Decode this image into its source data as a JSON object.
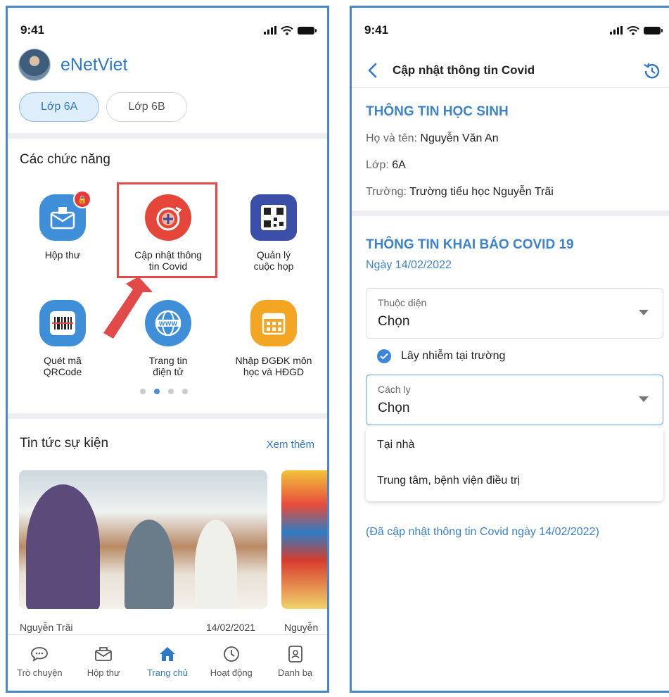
{
  "left": {
    "status_time": "9:41",
    "app_title": "eNetViet",
    "class_tabs": [
      "Lớp 6A",
      "Lớp 6B"
    ],
    "functions_title": "Các chức năng",
    "functions": [
      {
        "label1": "Hộp thư",
        "label2": "",
        "icon": "mailbox-icon",
        "color": "#3f8fd8"
      },
      {
        "label1": "Cập nhật thông",
        "label2": "tin Covid",
        "icon": "covid-update-icon",
        "color": "#e4473a"
      },
      {
        "label1": "Quản lý",
        "label2": "cuộc họp",
        "icon": "qr-meeting-icon",
        "color": "#3b4fa8"
      },
      {
        "label1": "Quét mã",
        "label2": "QRCode",
        "icon": "barcode-scan-icon",
        "color": "#3f8fd8"
      },
      {
        "label1": "Trang tin",
        "label2": "điện tử",
        "icon": "globe-www-icon",
        "color": "#3f8fd8"
      },
      {
        "label1": "Nhập ĐGĐK môn",
        "label2": "học và HĐGD",
        "icon": "calendar-grid-icon",
        "color": "#f2a623"
      }
    ],
    "news_title": "Tin tức sự kiện",
    "see_more": "Xem thêm",
    "news": [
      {
        "source": "Nguyễn Trãi",
        "date": "14/02/2021"
      },
      {
        "source": "Nguyễn",
        "date": ""
      }
    ],
    "nav": [
      {
        "label": "Trò chuyện",
        "icon": "chat-icon"
      },
      {
        "label": "Hộp thư",
        "icon": "mail-icon"
      },
      {
        "label": "Trang chủ",
        "icon": "home-icon"
      },
      {
        "label": "Hoạt động",
        "icon": "clock-icon"
      },
      {
        "label": "Danh bạ",
        "icon": "contacts-icon"
      }
    ]
  },
  "right": {
    "status_time": "9:41",
    "title": "Cập nhật thông tin Covid",
    "student_section": "THÔNG TIN HỌC SINH",
    "name_label": "Họ và tên:",
    "name_value": "Nguyễn Văn An",
    "class_label": "Lớp:",
    "class_value": "6A",
    "school_label": "Trường:",
    "school_value": "Trường tiểu học Nguyễn Trãi",
    "covid_section": "THÔNG TIN KHAI BÁO COVID 19",
    "date": "Ngày 14/02/2022",
    "field1_label": "Thuộc diện",
    "field1_value": "Chọn",
    "checkbox_label": "Lây nhiễm tại trường",
    "field2_label": "Cách ly",
    "field2_value": "Chọn",
    "options": [
      "Tại nhà",
      "Trung tâm, bệnh viện điều trị"
    ],
    "updated_note": "(Đã cập nhật thông tin Covid ngày 14/02/2022)"
  }
}
